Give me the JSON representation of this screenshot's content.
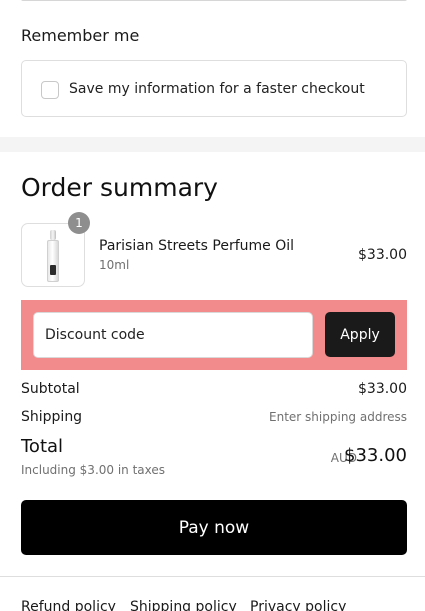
{
  "remember": {
    "title": "Remember me",
    "checkbox_label": "Save my information for a faster checkout",
    "checked": false
  },
  "summary": {
    "title": "Order summary",
    "item": {
      "quantity": "1",
      "name": "Parisian Streets Perfume Oil",
      "variant": "10ml",
      "price": "$33.00"
    },
    "discount": {
      "placeholder": "Discount code",
      "apply_label": "Apply"
    },
    "subtotal_label": "Subtotal",
    "subtotal_value": "$33.00",
    "shipping_label": "Shipping",
    "shipping_value": "Enter shipping address",
    "total_label": "Total",
    "tax_note": "Including $3.00 in taxes",
    "currency": "AUD",
    "total_value": "$33.00"
  },
  "pay_label": "Pay now",
  "footer": {
    "links": [
      "Refund policy",
      "Shipping policy",
      "Privacy policy"
    ]
  },
  "colors": {
    "discount_highlight": "#f28b8b",
    "pay_button": "#000000",
    "apply_button": "#1a1a1a"
  }
}
